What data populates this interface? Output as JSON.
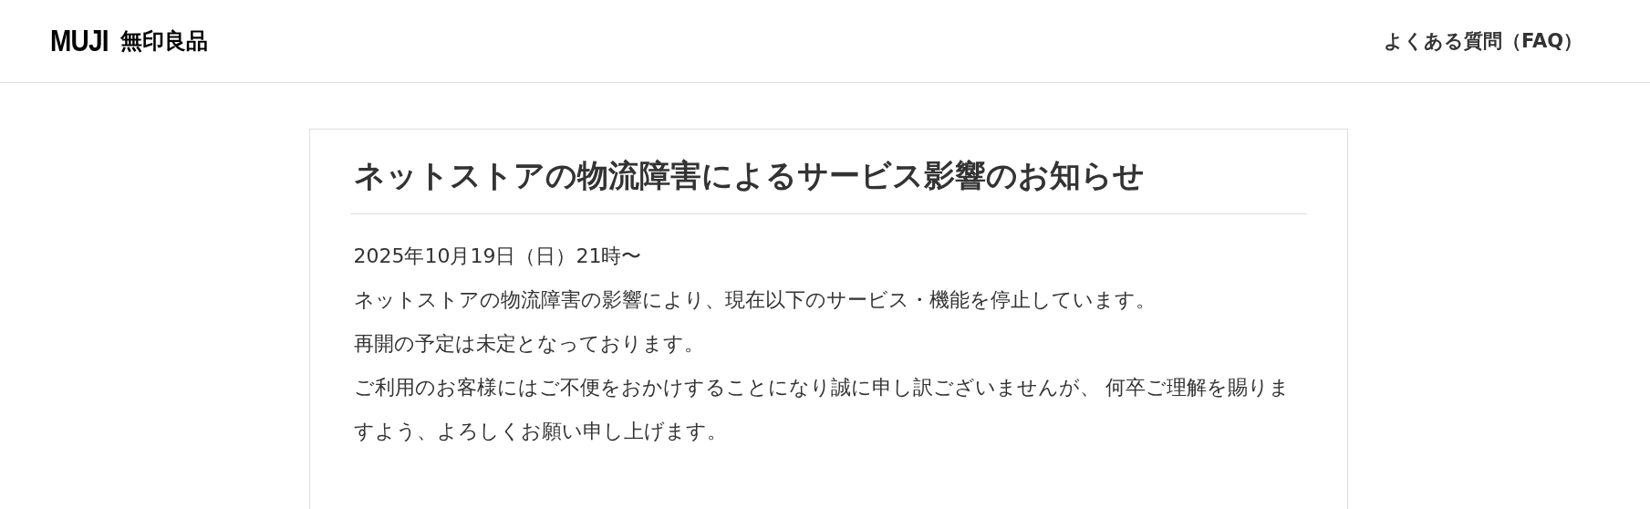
{
  "header": {
    "logo": {
      "latin": "MUJI",
      "japanese": "無印良品"
    },
    "nav_link": "よくある質問（FAQ）"
  },
  "notice": {
    "title": "ネットストアの物流障害によるサービス影響のお知らせ",
    "paragraphs": [
      "2025年10月19日（日）21時〜",
      "ネットストアの物流障害の影響により、現在以下のサービス・機能を停止しています。",
      "再開の予定は未定となっております。",
      "ご利用のお客様にはご不便をおかけすることになり誠に申し訳ございませんが、 何卒ご理解を賜りますよう、よろしくお願い申し上げます。"
    ]
  }
}
